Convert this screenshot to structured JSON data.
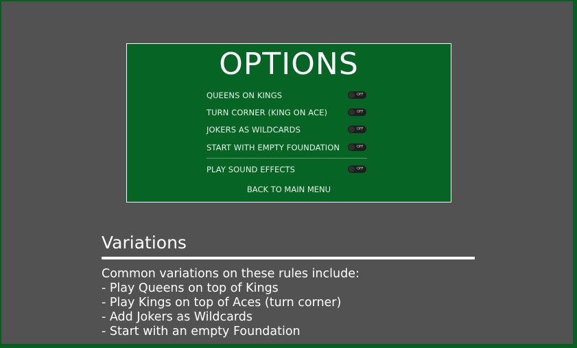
{
  "options": {
    "title": "OPTIONS",
    "items": [
      {
        "label": "QUEENS ON KINGS",
        "state": "OFF"
      },
      {
        "label": "TURN CORNER (KING ON ACE)",
        "state": "OFF"
      },
      {
        "label": "JOKERS AS WILDCARDS",
        "state": "OFF"
      },
      {
        "label": "START WITH EMPTY FOUNDATION",
        "state": "OFF"
      },
      {
        "label": "PLAY SOUND EFFECTS",
        "state": "OFF"
      }
    ],
    "back_label": "BACK TO MAIN MENU"
  },
  "variations": {
    "heading": "Variations",
    "lines": [
      "Common variations on these rules include:",
      "- Play Queens on top of Kings",
      "- Play Kings on top of Aces (turn corner)",
      "- Add Jokers as Wildcards",
      "- Start with an empty Foundation"
    ]
  },
  "colors": {
    "outer_border": "#0b5e22",
    "background": "#525252",
    "panel": "#066424",
    "text": "#ffffff"
  }
}
